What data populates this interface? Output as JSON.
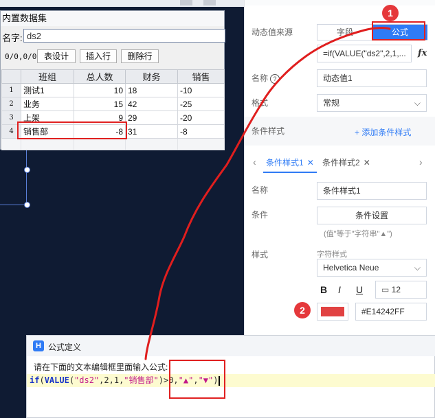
{
  "dataset_dialog": {
    "title": "内置数据集",
    "name_label": "名字:",
    "name_value": "ds2",
    "position": "0/0,0/0",
    "buttons": [
      "表设计",
      "插入行",
      "删除行"
    ],
    "columns": [
      "",
      "班组",
      "总人数",
      "财务",
      "销售"
    ],
    "rows": [
      {
        "n": "1",
        "team": "测试1",
        "total": "10",
        "finance": "18",
        "sales": "-10"
      },
      {
        "n": "2",
        "team": "业务",
        "total": "15",
        "finance": "42",
        "sales": "-25"
      },
      {
        "n": "3",
        "team": "上架",
        "total": "9",
        "finance": "29",
        "sales": "-20"
      },
      {
        "n": "4",
        "team": "销售部",
        "total": "-8",
        "finance": "31",
        "sales": "-8"
      }
    ]
  },
  "panel": {
    "source_label": "动态值来源",
    "source_options": [
      "字段",
      "公式"
    ],
    "formula_value": "=if(VALUE(\"ds2\",2,1,...",
    "fx": "fx",
    "name_label": "名称",
    "name_help": "?",
    "name_value": "动态值1",
    "format_label": "格式",
    "format_value": "常规",
    "cond_style_label": "条件样式",
    "add_cond": "+ 添加条件样式",
    "tabs": [
      "条件样式1",
      "条件样式2"
    ],
    "cond_name_label": "名称",
    "cond_name_value": "条件样式1",
    "condition_label": "条件",
    "condition_button": "条件设置",
    "condition_hint": "(值\"等于\"字符串\"▲\")",
    "style_label": "样式",
    "font_style_label": "字符样式",
    "font_value": "Helvetica Neue",
    "bold": "B",
    "italic": "I",
    "underline": "U",
    "font_size": "12",
    "color_hex": "#E14242FF",
    "color": "#e14242"
  },
  "badges": [
    "1",
    "2"
  ],
  "formula_dialog": {
    "title": "公式定义",
    "prompt": "请在下面的文本编辑框里面输入公式:",
    "code": {
      "kw_if": "if",
      "p1": "(",
      "kw_value": "VALUE",
      "p2": "(",
      "s_ds": "\"ds2\"",
      "args": ",2,1,",
      "s_dept": "\"销售部\"",
      "cmp": ")>0,",
      "s_up": "\"▲\"",
      "comma": ",",
      "s_down": "\"▼\"",
      "close": ")"
    }
  }
}
